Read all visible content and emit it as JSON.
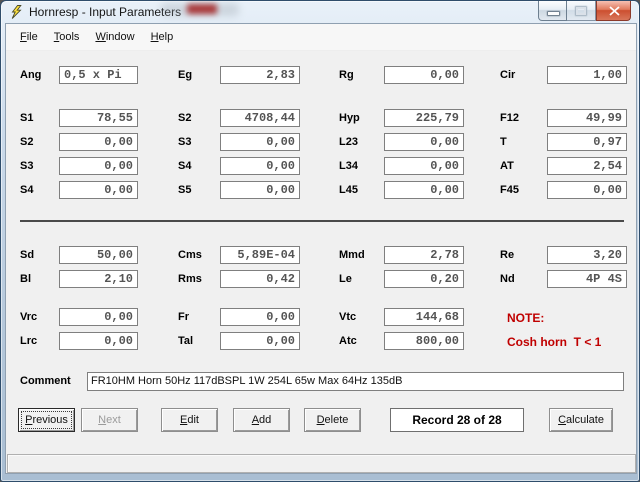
{
  "window": {
    "title": "Hornresp - Input Parameters",
    "controls": {
      "minimize": "minimize",
      "maximize": "maximize (disabled)",
      "close": "close"
    }
  },
  "menu": {
    "items": [
      {
        "label": "File"
      },
      {
        "label": "Tools"
      },
      {
        "label": "Window"
      },
      {
        "label": "Help"
      }
    ]
  },
  "fields": {
    "sections": [
      {
        "name": "general",
        "rows": [
          [
            {
              "label": "Ang",
              "value": "0,5 x Pi",
              "align": "left"
            },
            {
              "label": "Eg",
              "value": "2,83"
            },
            {
              "label": "Rg",
              "value": "0,00"
            },
            {
              "label": "Cir",
              "value": "1,00"
            }
          ]
        ]
      },
      {
        "name": "horn-segments",
        "rows": [
          [
            {
              "label": "S1",
              "value": "78,55"
            },
            {
              "label": "S2",
              "value": "4708,44"
            },
            {
              "label": "Hyp",
              "value": "225,79"
            },
            {
              "label": "F12",
              "value": "49,99"
            }
          ],
          [
            {
              "label": "S2",
              "value": "0,00"
            },
            {
              "label": "S3",
              "value": "0,00"
            },
            {
              "label": "L23",
              "value": "0,00"
            },
            {
              "label": "T",
              "value": "0,97"
            }
          ],
          [
            {
              "label": "S3",
              "value": "0,00"
            },
            {
              "label": "S4",
              "value": "0,00"
            },
            {
              "label": "L34",
              "value": "0,00"
            },
            {
              "label": "AT",
              "value": "2,54"
            }
          ],
          [
            {
              "label": "S4",
              "value": "0,00"
            },
            {
              "label": "S5",
              "value": "0,00"
            },
            {
              "label": "L45",
              "value": "0,00"
            },
            {
              "label": "F45",
              "value": "0,00"
            }
          ]
        ]
      },
      {
        "name": "driver",
        "rows": [
          [
            {
              "label": "Sd",
              "value": "50,00"
            },
            {
              "label": "Cms",
              "value": "5,89E-04"
            },
            {
              "label": "Mmd",
              "value": "2,78"
            },
            {
              "label": "Re",
              "value": "3,20"
            }
          ],
          [
            {
              "label": "Bl",
              "value": "2,10"
            },
            {
              "label": "Rms",
              "value": "0,42"
            },
            {
              "label": "Le",
              "value": "0,20"
            },
            {
              "label": "Nd",
              "value": "4P 4S"
            }
          ]
        ]
      },
      {
        "name": "chambers",
        "rows": [
          [
            {
              "label": "Vrc",
              "value": "0,00"
            },
            {
              "label": "Fr",
              "value": "0,00"
            },
            {
              "label": "Vtc",
              "value": "144,68"
            }
          ],
          [
            {
              "label": "Lrc",
              "value": "0,00"
            },
            {
              "label": "Tal",
              "value": "0,00"
            },
            {
              "label": "Atc",
              "value": "800,00"
            }
          ]
        ]
      }
    ]
  },
  "note": {
    "heading": "NOTE:",
    "text": "Cosh horn  T < 1",
    "color": "#c00000"
  },
  "comment": {
    "label": "Comment",
    "value": "FR10HM Horn 50Hz 117dBSPL 1W 254L 65w Max 64Hz 135dB"
  },
  "buttons": {
    "previous": {
      "label": "Previous",
      "state": "focused"
    },
    "next": {
      "label": "Next",
      "state": "disabled"
    },
    "edit": {
      "label": "Edit"
    },
    "add": {
      "label": "Add"
    },
    "delete": {
      "label": "Delete"
    },
    "calculate": {
      "label": "Calculate"
    }
  },
  "record_indicator": "Record 28 of 28",
  "colors": {
    "note_red": "#c00000",
    "client_background": "#f0f0f0",
    "titlebar_glass": "#cddcec",
    "field_value_gray": "#545454"
  }
}
